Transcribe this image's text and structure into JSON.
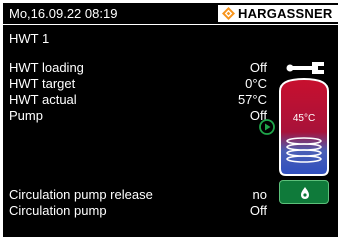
{
  "header": {
    "datetime": "Mo,16.09.22 08:19",
    "brand": "HARGASSNER"
  },
  "screen": {
    "title": "HWT 1"
  },
  "rows": [
    {
      "label": "HWT loading",
      "value": "Off"
    },
    {
      "label": "HWT target",
      "value": "0°C"
    },
    {
      "label": "HWT actual",
      "value": "57°C"
    },
    {
      "label": "Pump",
      "value": "Off"
    }
  ],
  "circulation": [
    {
      "label": "Circulation pump release",
      "value": "no"
    },
    {
      "label": "Circulation pump",
      "value": "Off"
    }
  ],
  "tank": {
    "temperature": "45°C"
  },
  "icons": {
    "brand": "hargassner-logo-icon",
    "tool": "wrench-icon",
    "pump": "pump-play-icon",
    "tank": "water-tank-icon",
    "circulation": "circulation-button-icon"
  },
  "colors": {
    "background": "#000000",
    "text": "#ffffff",
    "brand_accent": "#f7941d",
    "tank_hot": "#c8102e",
    "pump_green": "#1fa64a",
    "button_green": "#0f7a3a"
  }
}
